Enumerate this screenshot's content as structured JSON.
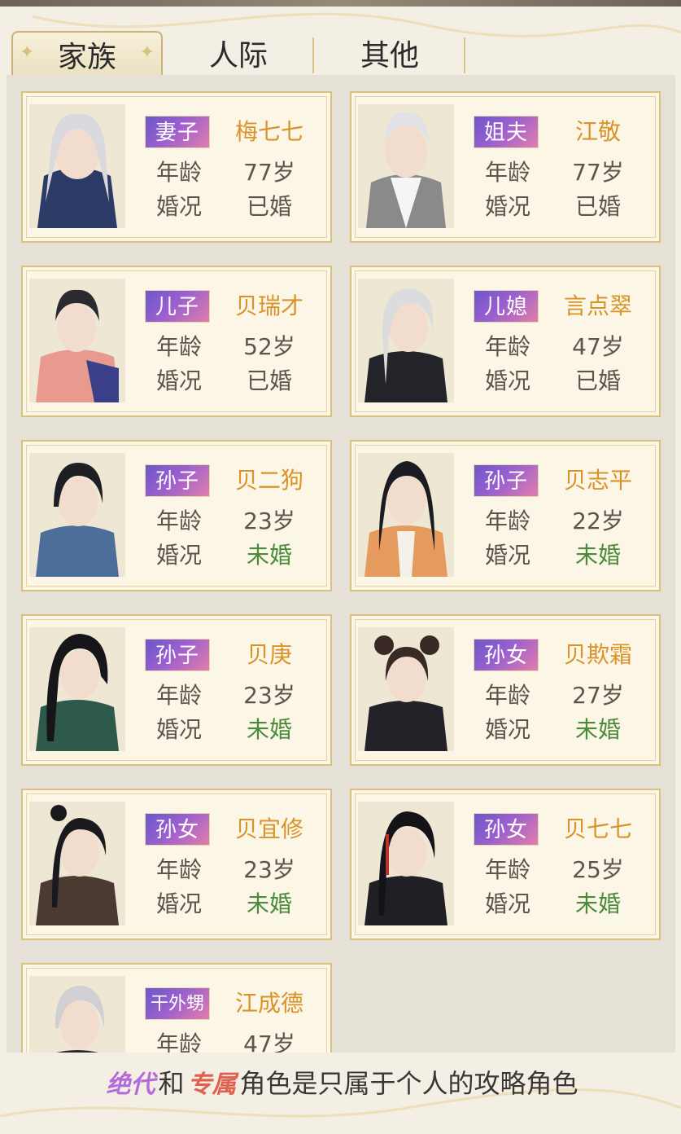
{
  "tabs": [
    {
      "label": "家族",
      "active": true
    },
    {
      "label": "人际",
      "active": false
    },
    {
      "label": "其他",
      "active": false
    }
  ],
  "labels": {
    "age": "年龄",
    "marital": "婚况"
  },
  "cards": [
    {
      "relation": "妻子",
      "name": "梅七七",
      "age": "77岁",
      "marital": "已婚"
    },
    {
      "relation": "姐夫",
      "name": "江敬",
      "age": "77岁",
      "marital": "已婚"
    },
    {
      "relation": "儿子",
      "name": "贝瑞才",
      "age": "52岁",
      "marital": "已婚"
    },
    {
      "relation": "儿媳",
      "name": "言点翠",
      "age": "47岁",
      "marital": "已婚"
    },
    {
      "relation": "孙子",
      "name": "贝二狗",
      "age": "23岁",
      "marital": "未婚"
    },
    {
      "relation": "孙子",
      "name": "贝志平",
      "age": "22岁",
      "marital": "未婚"
    },
    {
      "relation": "孙子",
      "name": "贝庚",
      "age": "23岁",
      "marital": "未婚"
    },
    {
      "relation": "孙女",
      "name": "贝欺霜",
      "age": "27岁",
      "marital": "未婚"
    },
    {
      "relation": "孙女",
      "name": "贝宜修",
      "age": "23岁",
      "marital": "未婚"
    },
    {
      "relation": "孙女",
      "name": "贝七七",
      "age": "25岁",
      "marital": "未婚"
    },
    {
      "relation": "干外甥",
      "name": "江成德",
      "age": "47岁",
      "marital": ""
    }
  ],
  "footer": {
    "tag_jueddai": "绝代",
    "connector": "和",
    "tag_zhuanshu": "专属",
    "text": "角色是只属于个人的攻略角色"
  },
  "colors": {
    "name": "#d8932b",
    "unmarried": "#4a8a3a",
    "badge_gradient": [
      "#6d57c9",
      "#9a5fcf",
      "#e27dac"
    ],
    "card_border": "#d9c07e"
  }
}
